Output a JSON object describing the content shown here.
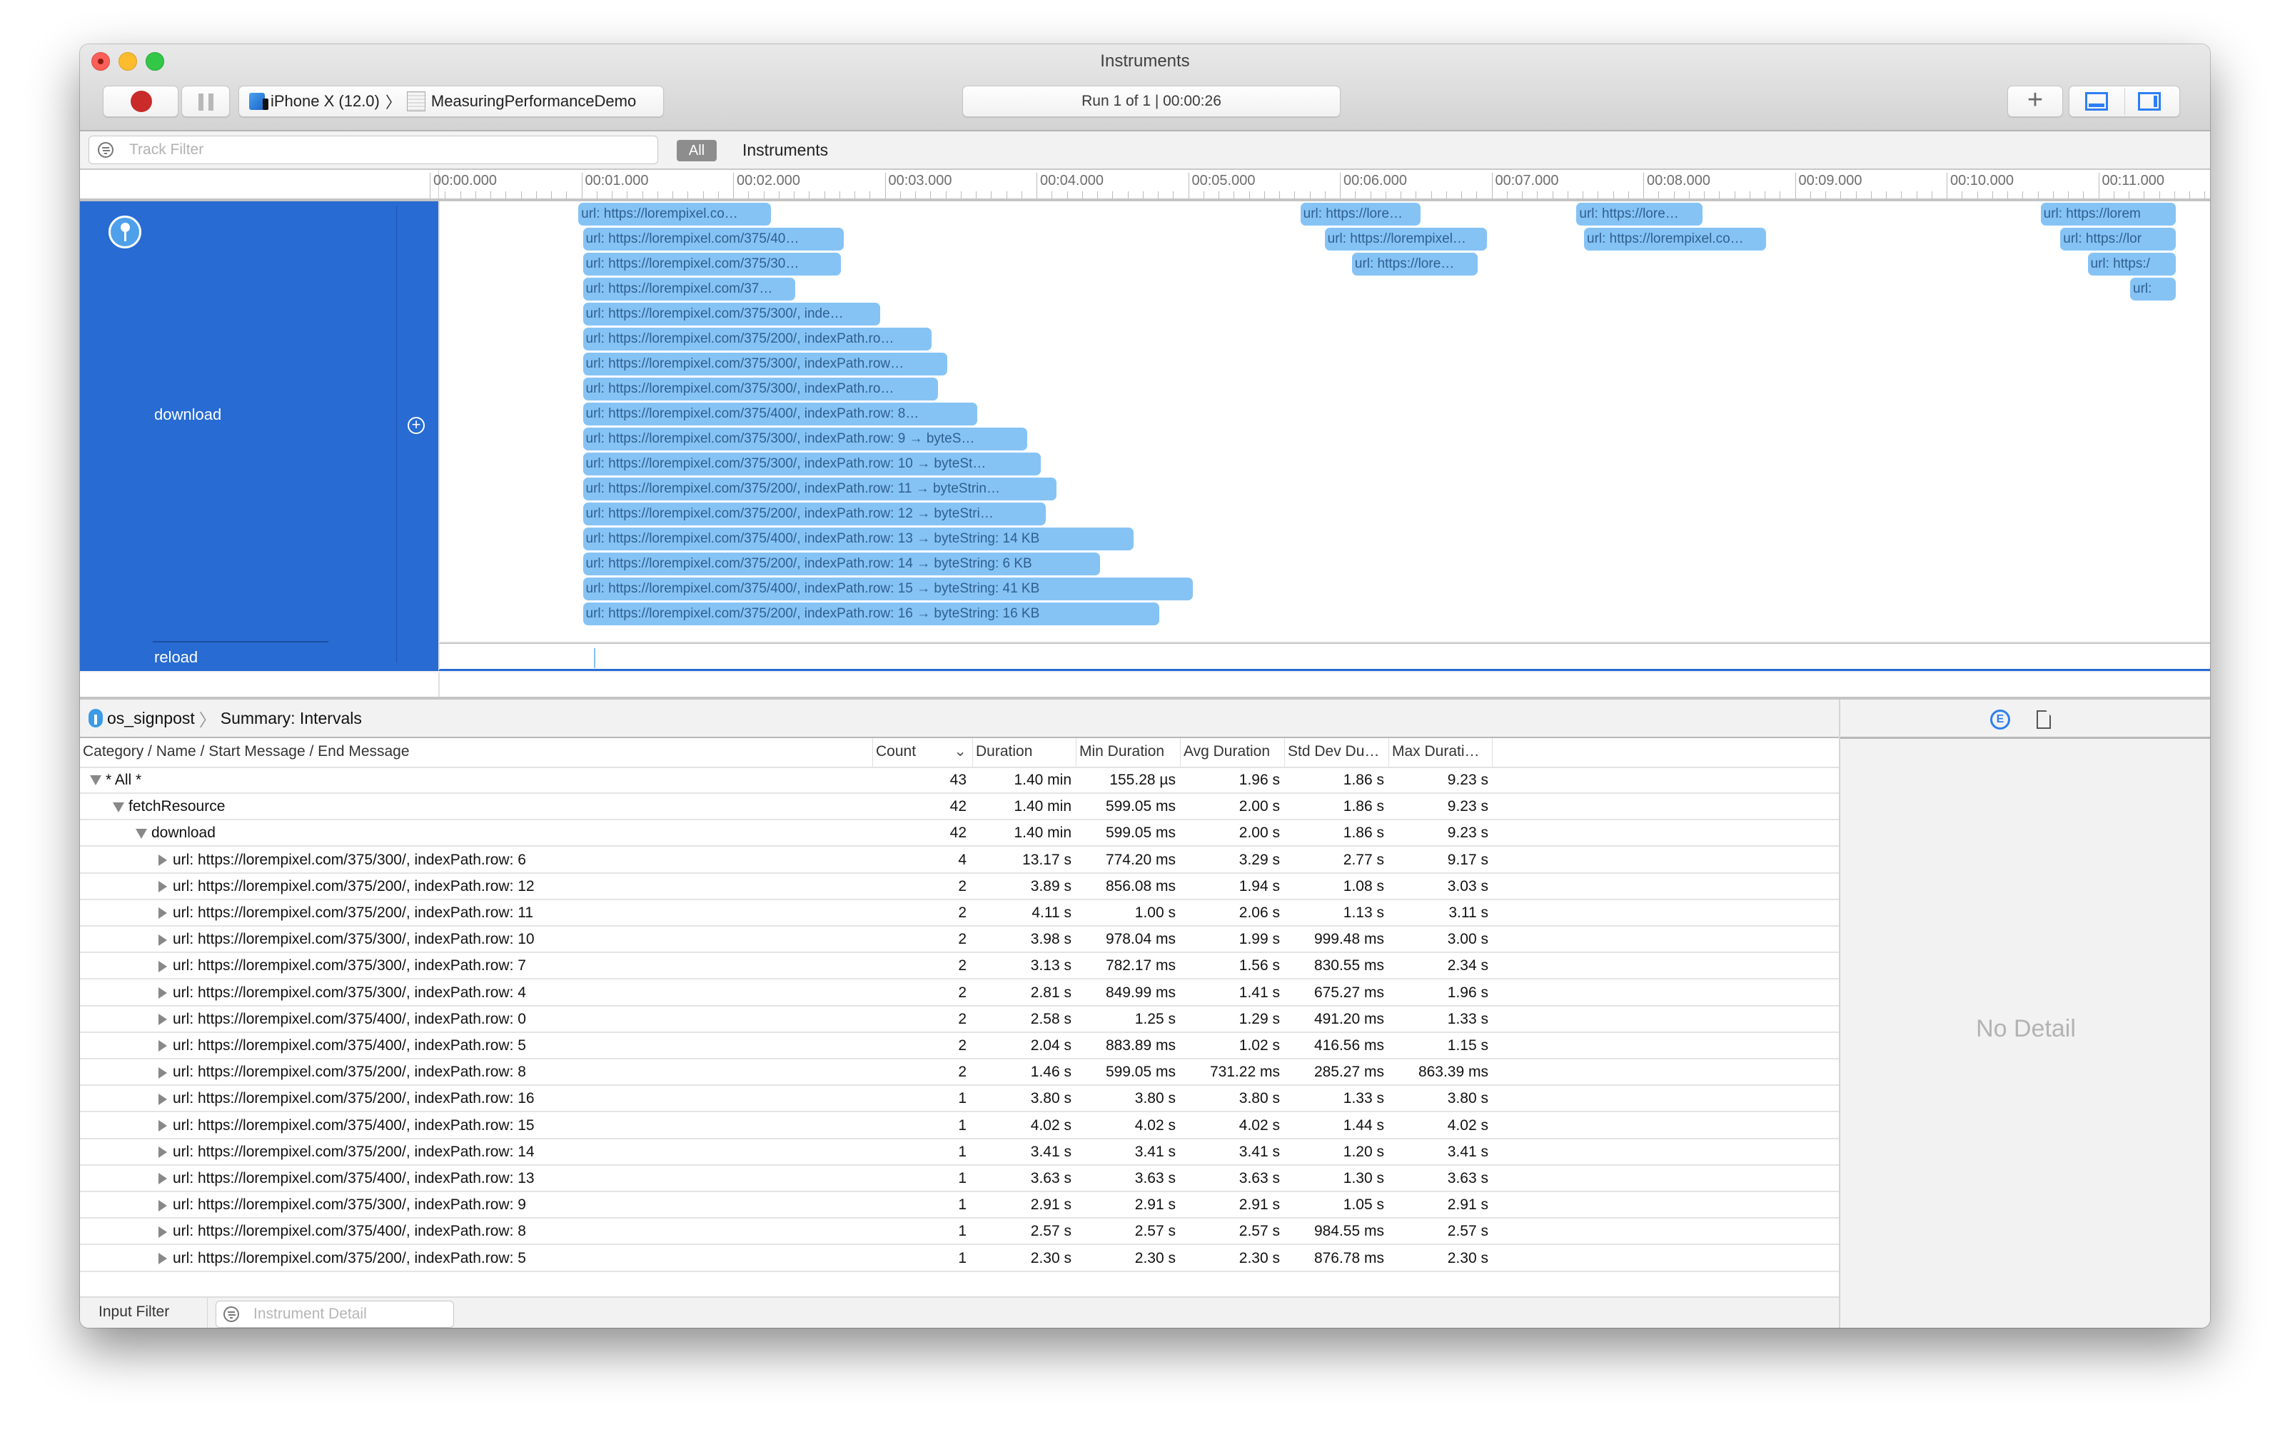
{
  "window": {
    "title": "Instruments",
    "device": "iPhone X (12.0)",
    "app": "MeasuringPerformanceDemo",
    "run_status": "Run 1 of 1  |  00:00:26"
  },
  "filter_bar": {
    "track_filter_placeholder": "Track Filter",
    "all_chip": "All",
    "instruments_label": "Instruments"
  },
  "ruler": {
    "ticks": [
      "00:00.000",
      "00:01.000",
      "00:02.000",
      "00:03.000",
      "00:04.000",
      "00:05.000",
      "00:06.000",
      "00:07.000",
      "00:08.000",
      "00:09.000",
      "00:10.000",
      "00:11.000"
    ]
  },
  "track": {
    "name": "download",
    "secondary": "reload",
    "accent": "#276bd3",
    "interval_color": "#86c3f5",
    "intervals": [
      {
        "label": "url: https://lorempixel.co…",
        "start": 0.97,
        "end": 2.24,
        "lane": 0
      },
      {
        "label": "url: https://lorempixel.com/375/40…",
        "start": 1.0,
        "end": 2.72,
        "lane": 1
      },
      {
        "label": "url: https://lorempixel.com/375/30…",
        "start": 1.0,
        "end": 2.7,
        "lane": 2
      },
      {
        "label": "url: https://lorempixel.com/37…",
        "start": 1.0,
        "end": 2.4,
        "lane": 3
      },
      {
        "label": "url: https://lorempixel.com/375/300/, inde…",
        "start": 1.0,
        "end": 2.96,
        "lane": 4
      },
      {
        "label": "url: https://lorempixel.com/375/200/, indexPath.ro…",
        "start": 1.0,
        "end": 3.3,
        "lane": 5
      },
      {
        "label": "url: https://lorempixel.com/375/300/, indexPath.row…",
        "start": 1.0,
        "end": 3.4,
        "lane": 6
      },
      {
        "label": "url: https://lorempixel.com/375/300/, indexPath.ro…",
        "start": 1.0,
        "end": 3.34,
        "lane": 7
      },
      {
        "label": "url: https://lorempixel.com/375/400/, indexPath.row: 8…",
        "start": 1.0,
        "end": 3.6,
        "lane": 8
      },
      {
        "label": "url: https://lorempixel.com/375/300/, indexPath.row: 9 → byteS…",
        "start": 1.0,
        "end": 3.93,
        "lane": 9
      },
      {
        "label": "url: https://lorempixel.com/375/300/, indexPath.row: 10 → byteSt…",
        "start": 1.0,
        "end": 4.02,
        "lane": 10
      },
      {
        "label": "url: https://lorempixel.com/375/200/, indexPath.row: 11 → byteStrin…",
        "start": 1.0,
        "end": 4.12,
        "lane": 11
      },
      {
        "label": "url: https://lorempixel.com/375/200/, indexPath.row: 12 → byteStri…",
        "start": 1.0,
        "end": 4.05,
        "lane": 12
      },
      {
        "label": "url: https://lorempixel.com/375/400/, indexPath.row: 13 → byteString: 14 KB",
        "start": 1.0,
        "end": 4.63,
        "lane": 13
      },
      {
        "label": "url: https://lorempixel.com/375/200/, indexPath.row: 14 → byteString: 6 KB",
        "start": 1.0,
        "end": 4.41,
        "lane": 14
      },
      {
        "label": "url: https://lorempixel.com/375/400/, indexPath.row: 15 → byteString: 41 KB",
        "start": 1.0,
        "end": 5.02,
        "lane": 15
      },
      {
        "label": "url: https://lorempixel.com/375/200/, indexPath.row: 16 → byteString: 16 KB",
        "start": 1.0,
        "end": 4.8,
        "lane": 16
      },
      {
        "label": "url: https://lore…",
        "start": 5.73,
        "end": 6.52,
        "lane": 0
      },
      {
        "label": "url: https://lorempixel…",
        "start": 5.89,
        "end": 6.96,
        "lane": 1
      },
      {
        "label": "url: https://lore…",
        "start": 6.07,
        "end": 6.9,
        "lane": 2
      },
      {
        "label": "url: https://lore…",
        "start": 7.55,
        "end": 8.38,
        "lane": 0
      },
      {
        "label": "url: https://lorempixel.co…",
        "start": 7.6,
        "end": 8.8,
        "lane": 1
      },
      {
        "label": "url: https://lorem",
        "start": 10.61,
        "end": 11.5,
        "lane": 0
      },
      {
        "label": "url: https://lor",
        "start": 10.74,
        "end": 11.5,
        "lane": 1
      },
      {
        "label": "url: https:/",
        "start": 10.92,
        "end": 11.5,
        "lane": 2
      },
      {
        "label": "url:",
        "start": 11.2,
        "end": 11.5,
        "lane": 3
      }
    ]
  },
  "detail": {
    "breadcrumb": [
      "os_signpost",
      "Summary: Intervals"
    ],
    "columns": [
      "Category / Name / Start Message / End Message",
      "Count",
      "Duration",
      "Min Duration",
      "Avg Duration",
      "Std Dev Du…",
      "Max Durati…"
    ],
    "rows": [
      {
        "name": "* All *",
        "level": 0,
        "expanded": true,
        "count": "43",
        "duration": "1.40 min",
        "min": "155.28 µs",
        "avg": "1.96 s",
        "std": "1.86 s",
        "max": "9.23 s"
      },
      {
        "name": "fetchResource",
        "level": 1,
        "expanded": true,
        "count": "42",
        "duration": "1.40 min",
        "min": "599.05 ms",
        "avg": "2.00 s",
        "std": "1.86 s",
        "max": "9.23 s"
      },
      {
        "name": "download",
        "level": 2,
        "expanded": true,
        "count": "42",
        "duration": "1.40 min",
        "min": "599.05 ms",
        "avg": "2.00 s",
        "std": "1.86 s",
        "max": "9.23 s"
      },
      {
        "name": "url: https://lorempixel.com/375/300/, indexPath.row: 6",
        "level": 3,
        "expanded": false,
        "count": "4",
        "duration": "13.17 s",
        "min": "774.20 ms",
        "avg": "3.29 s",
        "std": "2.77 s",
        "max": "9.17 s"
      },
      {
        "name": "url: https://lorempixel.com/375/200/, indexPath.row: 12",
        "level": 3,
        "expanded": false,
        "count": "2",
        "duration": "3.89 s",
        "min": "856.08 ms",
        "avg": "1.94 s",
        "std": "1.08 s",
        "max": "3.03 s"
      },
      {
        "name": "url: https://lorempixel.com/375/200/, indexPath.row: 11",
        "level": 3,
        "expanded": false,
        "count": "2",
        "duration": "4.11 s",
        "min": "1.00 s",
        "avg": "2.06 s",
        "std": "1.13 s",
        "max": "3.11 s"
      },
      {
        "name": "url: https://lorempixel.com/375/300/, indexPath.row: 10",
        "level": 3,
        "expanded": false,
        "count": "2",
        "duration": "3.98 s",
        "min": "978.04 ms",
        "avg": "1.99 s",
        "std": "999.48 ms",
        "max": "3.00 s"
      },
      {
        "name": "url: https://lorempixel.com/375/300/, indexPath.row: 7",
        "level": 3,
        "expanded": false,
        "count": "2",
        "duration": "3.13 s",
        "min": "782.17 ms",
        "avg": "1.56 s",
        "std": "830.55 ms",
        "max": "2.34 s"
      },
      {
        "name": "url: https://lorempixel.com/375/300/, indexPath.row: 4",
        "level": 3,
        "expanded": false,
        "count": "2",
        "duration": "2.81 s",
        "min": "849.99 ms",
        "avg": "1.41 s",
        "std": "675.27 ms",
        "max": "1.96 s"
      },
      {
        "name": "url: https://lorempixel.com/375/400/, indexPath.row: 0",
        "level": 3,
        "expanded": false,
        "count": "2",
        "duration": "2.58 s",
        "min": "1.25 s",
        "avg": "1.29 s",
        "std": "491.20 ms",
        "max": "1.33 s"
      },
      {
        "name": "url: https://lorempixel.com/375/400/, indexPath.row: 5",
        "level": 3,
        "expanded": false,
        "count": "2",
        "duration": "2.04 s",
        "min": "883.89 ms",
        "avg": "1.02 s",
        "std": "416.56 ms",
        "max": "1.15 s"
      },
      {
        "name": "url: https://lorempixel.com/375/200/, indexPath.row: 8",
        "level": 3,
        "expanded": false,
        "count": "2",
        "duration": "1.46 s",
        "min": "599.05 ms",
        "avg": "731.22 ms",
        "std": "285.27 ms",
        "max": "863.39 ms"
      },
      {
        "name": "url: https://lorempixel.com/375/200/, indexPath.row: 16",
        "level": 3,
        "expanded": false,
        "count": "1",
        "duration": "3.80 s",
        "min": "3.80 s",
        "avg": "3.80 s",
        "std": "1.33 s",
        "max": "3.80 s"
      },
      {
        "name": "url: https://lorempixel.com/375/400/, indexPath.row: 15",
        "level": 3,
        "expanded": false,
        "count": "1",
        "duration": "4.02 s",
        "min": "4.02 s",
        "avg": "4.02 s",
        "std": "1.44 s",
        "max": "4.02 s"
      },
      {
        "name": "url: https://lorempixel.com/375/200/, indexPath.row: 14",
        "level": 3,
        "expanded": false,
        "count": "1",
        "duration": "3.41 s",
        "min": "3.41 s",
        "avg": "3.41 s",
        "std": "1.20 s",
        "max": "3.41 s"
      },
      {
        "name": "url: https://lorempixel.com/375/400/, indexPath.row: 13",
        "level": 3,
        "expanded": false,
        "count": "1",
        "duration": "3.63 s",
        "min": "3.63 s",
        "avg": "3.63 s",
        "std": "1.30 s",
        "max": "3.63 s"
      },
      {
        "name": "url: https://lorempixel.com/375/300/, indexPath.row: 9",
        "level": 3,
        "expanded": false,
        "count": "1",
        "duration": "2.91 s",
        "min": "2.91 s",
        "avg": "2.91 s",
        "std": "1.05 s",
        "max": "2.91 s"
      },
      {
        "name": "url: https://lorempixel.com/375/400/, indexPath.row: 8",
        "level": 3,
        "expanded": false,
        "count": "1",
        "duration": "2.57 s",
        "min": "2.57 s",
        "avg": "2.57 s",
        "std": "984.55 ms",
        "max": "2.57 s"
      },
      {
        "name": "url: https://lorempixel.com/375/200/, indexPath.row: 5",
        "level": 3,
        "expanded": false,
        "count": "1",
        "duration": "2.30 s",
        "min": "2.30 s",
        "avg": "2.30 s",
        "std": "876.78 ms",
        "max": "2.30 s"
      }
    ]
  },
  "footer": {
    "input_filter_label": "Input Filter",
    "instrument_detail_placeholder": "Instrument Detail"
  },
  "inspector": {
    "empty_text": "No Detail"
  }
}
